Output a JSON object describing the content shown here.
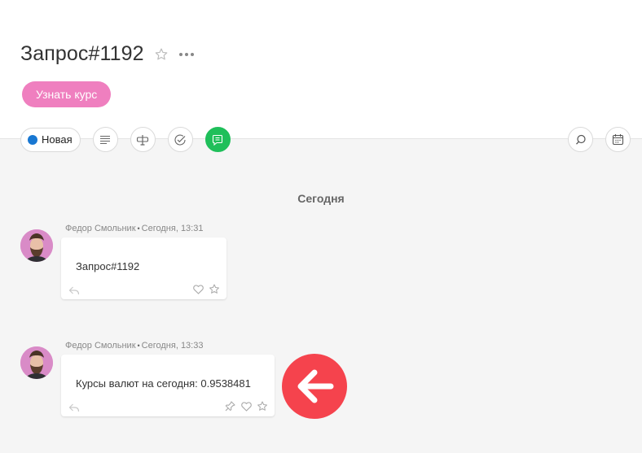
{
  "header": {
    "title": "Запрос#1192",
    "action_button": "Узнать курс"
  },
  "toolbar": {
    "status_label": "Новая",
    "status_color": "#1877d2",
    "icons": [
      "description-icon",
      "text-format-icon",
      "checklist-icon",
      "comments-icon"
    ],
    "right_icons": [
      "search-icon",
      "calendar-icon"
    ],
    "active_color": "#1fbf5a"
  },
  "feed": {
    "day_label": "Сегодня",
    "messages": [
      {
        "author": "Федор Смольник",
        "time": "Сегодня, 13:31",
        "text": "Запрос#1192"
      },
      {
        "author": "Федор Смольник",
        "time": "Сегодня, 13:33",
        "text": "Курсы валют на сегодня: 0.9538481"
      }
    ]
  },
  "colors": {
    "action_button": "#ef7fbf",
    "back_button": "#f5434d"
  }
}
